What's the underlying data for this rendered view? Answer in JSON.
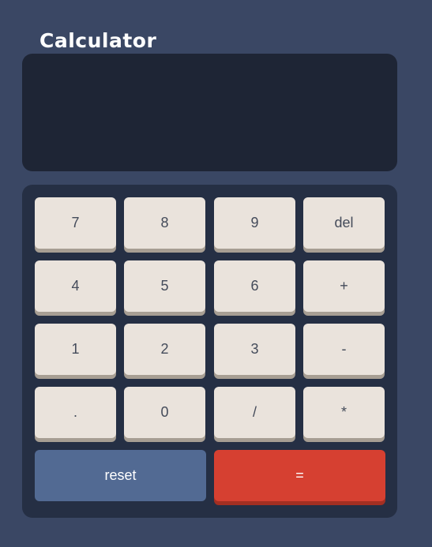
{
  "app": {
    "title": "Calculator"
  },
  "display": {
    "value": ""
  },
  "keys": {
    "seven": "7",
    "eight": "8",
    "nine": "9",
    "del": "del",
    "four": "4",
    "five": "5",
    "six": "6",
    "plus": "+",
    "one": "1",
    "two": "2",
    "three": "3",
    "minus": "-",
    "dot": ".",
    "zero": "0",
    "divide": "/",
    "multiply": "*",
    "reset": "reset",
    "equals": "="
  },
  "colors": {
    "background": "#3a4764",
    "display_background": "#1e2535",
    "keypad_background": "#252f44",
    "key_background": "#eae3dc",
    "key_shadow": "#a79e93",
    "reset_background": "#526a93",
    "equals_background": "#d64031"
  }
}
